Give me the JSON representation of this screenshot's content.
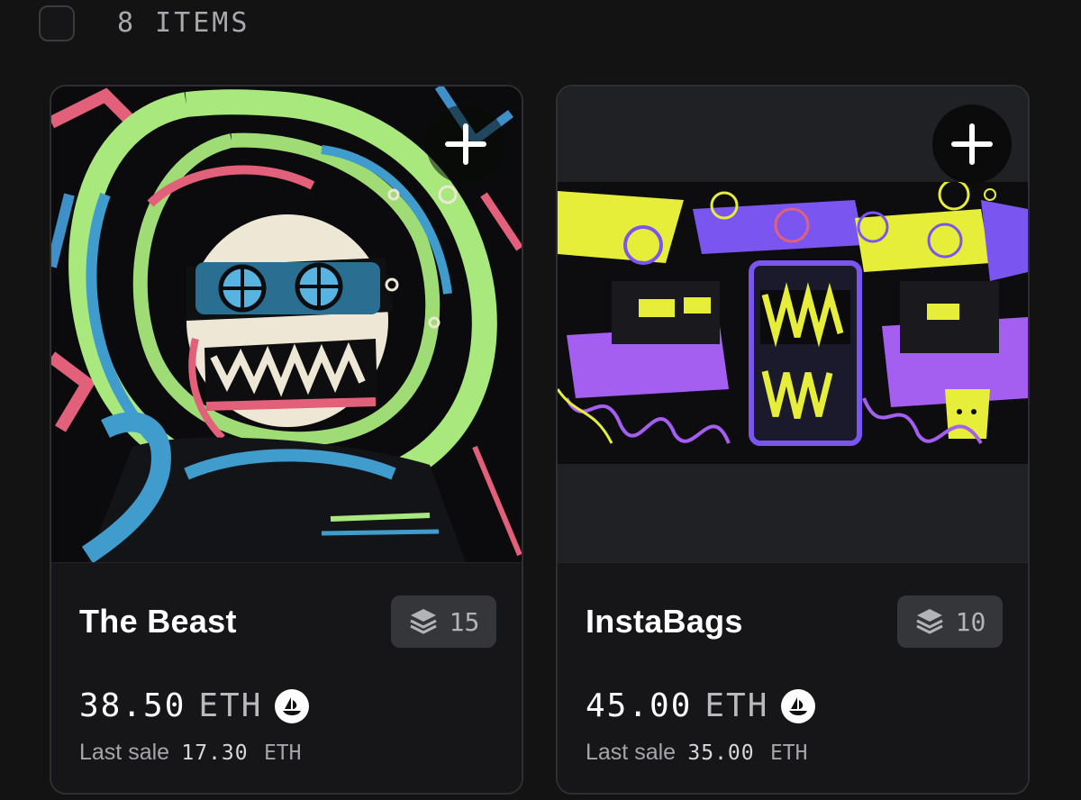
{
  "header": {
    "items_count": "8 ITEMS"
  },
  "colors": {
    "background": "#131314",
    "card": "#161618",
    "badge": "#35363a",
    "muted_text": "#a9a9ad"
  },
  "cards": [
    {
      "name": "The Beast",
      "artwork": "neon-skull-astronaut-art",
      "add_icon": "plus-icon",
      "stack_icon": "layers-icon",
      "quantity": "15",
      "price": "38.50",
      "currency": "ETH",
      "marketplace_icon": "opensea-icon",
      "last_sale_label": "Last sale",
      "last_sale_value": "17.30",
      "last_sale_currency": "ETH"
    },
    {
      "name": "InstaBags",
      "artwork": "purple-yellow-monsters-banner",
      "add_icon": "plus-icon",
      "stack_icon": "layers-icon",
      "quantity": "10",
      "price": "45.00",
      "currency": "ETH",
      "marketplace_icon": "opensea-icon",
      "last_sale_label": "Last sale",
      "last_sale_value": "35.00",
      "last_sale_currency": "ETH"
    }
  ]
}
